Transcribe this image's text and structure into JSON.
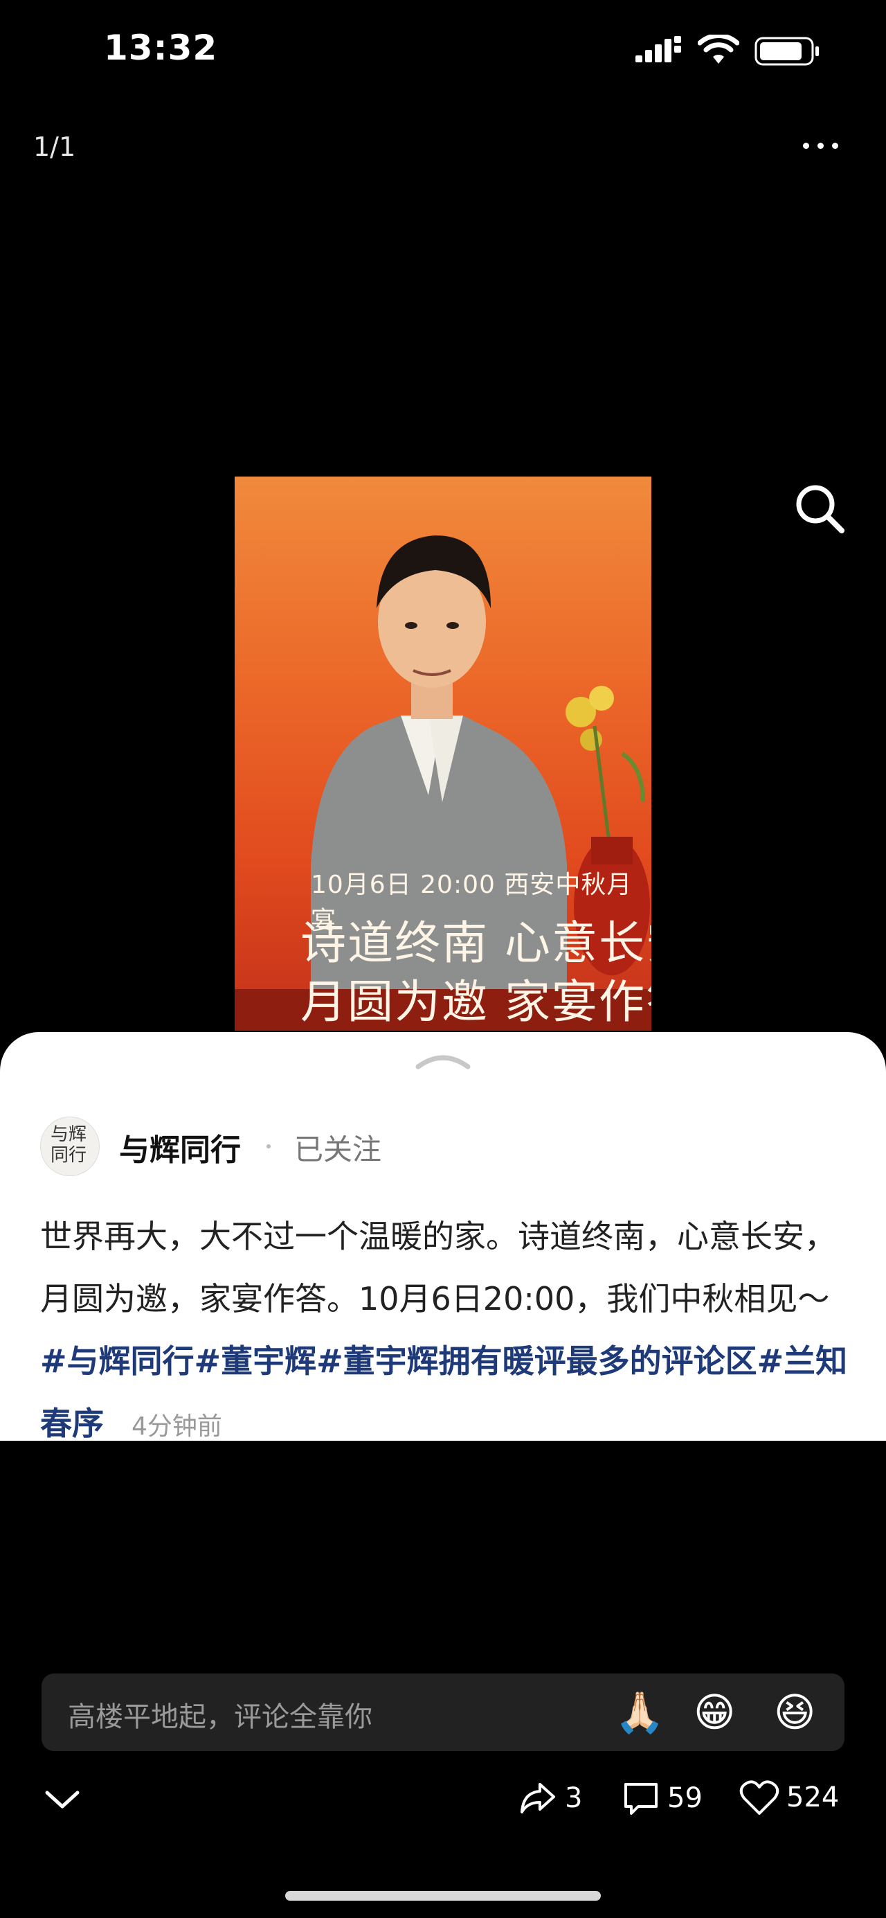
{
  "status_bar": {
    "time": "13:32"
  },
  "header": {
    "page_indicator": "1/1"
  },
  "poster": {
    "date_line": "10月6日 20:00  西安中秋月宴",
    "line1": "诗道终南 心意长安",
    "line2": "月圆为邀 家宴作答"
  },
  "post": {
    "avatar_text": "与辉同行",
    "author": "与辉同行",
    "follow_status": "已关注",
    "text": "世界再大，大不过一个温暖的家。诗道终南，心意长安，月圆为邀，家宴作答。10月6日20:00，我们中秋相见～ ",
    "hashtags": [
      "#与辉同行",
      "#董宇辉",
      "#董宇辉拥有暖评最多的评论区",
      "#兰知春序"
    ],
    "time_ago": "4分钟前"
  },
  "comment_input": {
    "placeholder": "高楼平地起，评论全靠你"
  },
  "emojis": [
    "🙏🏻",
    "😁",
    "😆"
  ],
  "actions": {
    "shares": "3",
    "comments": "59",
    "likes": "524"
  },
  "colors": {
    "hashtag": "#1f3a78",
    "poster_bg": "#e14a1e"
  }
}
